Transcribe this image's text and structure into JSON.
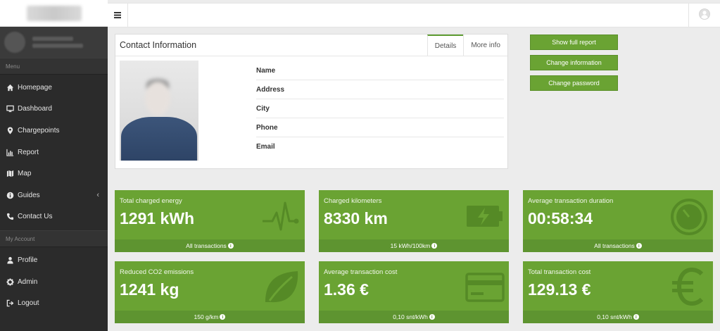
{
  "sidebar": {
    "menu_label": "Menu",
    "items": [
      {
        "label": "Homepage",
        "icon": "home-icon"
      },
      {
        "label": "Dashboard",
        "icon": "desktop-icon"
      },
      {
        "label": "Chargepoints",
        "icon": "map-marker-icon"
      },
      {
        "label": "Report",
        "icon": "bar-chart-icon"
      },
      {
        "label": "Map",
        "icon": "map-icon"
      },
      {
        "label": "Guides",
        "icon": "info-circle-icon"
      },
      {
        "label": "Contact Us",
        "icon": "phone-icon"
      }
    ],
    "account_label": "My Account",
    "account_items": [
      {
        "label": "Profile",
        "icon": "user-icon"
      },
      {
        "label": "Admin",
        "icon": "cog-icon"
      },
      {
        "label": "Logout",
        "icon": "sign-out-icon"
      }
    ]
  },
  "contact": {
    "title": "Contact Information",
    "tabs": [
      "Details",
      "More info"
    ],
    "fields": [
      {
        "label": "Name",
        "value": ""
      },
      {
        "label": "Address",
        "value": ""
      },
      {
        "label": "City",
        "value": ""
      },
      {
        "label": "Phone",
        "value": ""
      },
      {
        "label": "Email",
        "value": ""
      }
    ]
  },
  "actions": {
    "show_full_report": "Show full report",
    "change_information": "Change information",
    "change_password": "Change password"
  },
  "stats": [
    {
      "label": "Total charged energy",
      "value": "1291 kWh",
      "footer": "All transactions",
      "icon": "heartbeat-icon"
    },
    {
      "label": "Charged kilometers",
      "value": "8330 km",
      "footer": "15 kWh/100km",
      "icon": "battery-charging-icon"
    },
    {
      "label": "Average transaction duration",
      "value": "00:58:34",
      "footer": "All transactions",
      "icon": "stopwatch-icon"
    },
    {
      "label": "Reduced CO2 emissions",
      "value": "1241 kg",
      "footer": "150 g/km",
      "icon": "leaf-icon"
    },
    {
      "label": "Average transaction cost",
      "value": "1.36 €",
      "footer": "0,10 snt/kWh",
      "icon": "credit-card-icon"
    },
    {
      "label": "Total transaction cost",
      "value": "129.13 €",
      "footer": "0,10 snt/kWh",
      "icon": "euro-icon"
    }
  ],
  "colors": {
    "accent": "#6aa333",
    "sidebar": "#2b2b2b"
  }
}
